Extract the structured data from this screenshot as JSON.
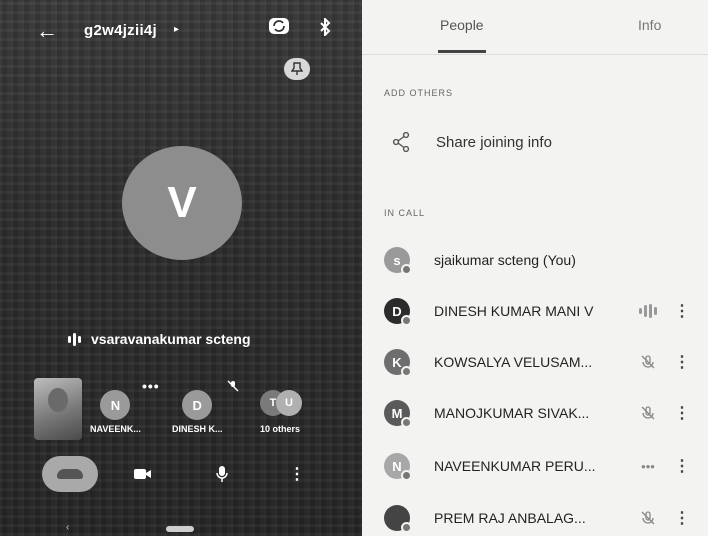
{
  "call": {
    "meeting_code": "g2w4jzii4j",
    "caret": "▸",
    "active_avatar_letter": "V",
    "active_speaker": "vsaravanakumar scteng",
    "tiles": [
      {
        "initial": "N",
        "label": "NAVEENK..."
      },
      {
        "initial": "D",
        "label": "DINESH K..."
      }
    ],
    "others": {
      "initial_a": "T",
      "initial_b": "U",
      "label": "10 others"
    },
    "tile_dots": "•••"
  },
  "panel": {
    "tab_people": "People",
    "tab_info": "Info",
    "add_others_heading": "ADD OTHERS",
    "share_label": "Share joining info",
    "in_call_heading": "IN CALL",
    "people": [
      {
        "initial": "s",
        "name": "sjaikumar scteng (You)",
        "status": "none",
        "color": "#9a9a9a"
      },
      {
        "initial": "D",
        "name": "DINESH KUMAR MANI V",
        "status": "speaking",
        "color": "#2b2b2b"
      },
      {
        "initial": "K",
        "name": "KOWSALYA VELUSAM...",
        "status": "muted",
        "color": "#6e6e6e"
      },
      {
        "initial": "M",
        "name": "MANOJKUMAR SIVAK...",
        "status": "muted",
        "color": "#5a5a5a"
      },
      {
        "initial": "N",
        "name": "NAVEENKUMAR PERU...",
        "status": "dots",
        "color": "#a7a7a7"
      },
      {
        "initial": "",
        "name": "PREM RAJ ANBALAG...",
        "status": "muted",
        "color": "#444444"
      }
    ],
    "status_dots": "•••"
  }
}
